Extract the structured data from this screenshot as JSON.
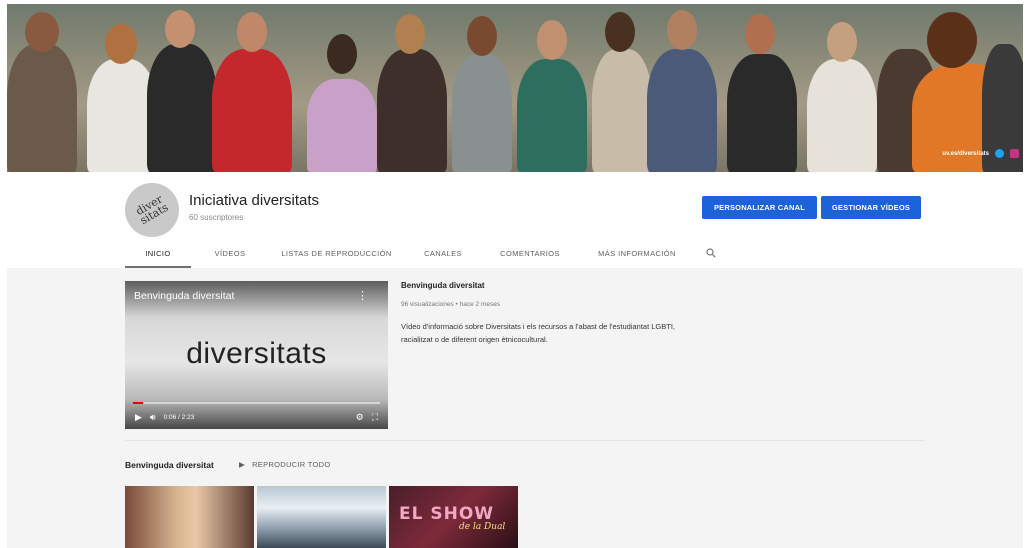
{
  "banner": {
    "handle": "uv.es/diversitats",
    "icons": [
      "twitter-icon",
      "instagram-icon"
    ]
  },
  "channel": {
    "name": "Iniciativa diversitats",
    "avatar_text": "diver sitats",
    "subscribers": "60 suscriptores",
    "buttons": {
      "customize": "PERSONALIZAR CANAL",
      "manage": "GESTIONAR VÍDEOS"
    }
  },
  "tabs": [
    {
      "label": "INICIO",
      "active": true
    },
    {
      "label": "VÍDEOS",
      "active": false
    },
    {
      "label": "LISTAS DE REPRODUCCIÓN",
      "active": false
    },
    {
      "label": "CANALES",
      "active": false
    },
    {
      "label": "COMENTARIOS",
      "active": false
    },
    {
      "label": "MÁS INFORMACIÓN",
      "active": false
    }
  ],
  "featured": {
    "player_title": "Benvinguda diversitat",
    "player_logo": "diversitats",
    "time": "0:06 / 2:23",
    "progress": 0.04,
    "title": "Benvinguda diversitat",
    "meta": "96 visualizaciones • hace 2 meses",
    "description": "Vídeo d'informació sobre Diversitats i els recursos a l'abast de l'estudiantat LGBTI, racialitzat o de diferent origen ètnicocultural."
  },
  "shelf": {
    "title": "Benvinguda diversitat",
    "play_all": "REPRODUCIR TODO"
  },
  "thumbnails": {
    "third_title": "EL SHOW",
    "third_subtitle": "de la Dual"
  },
  "colors": {
    "accent": "#1c62d8",
    "progress": "#ee0000"
  }
}
